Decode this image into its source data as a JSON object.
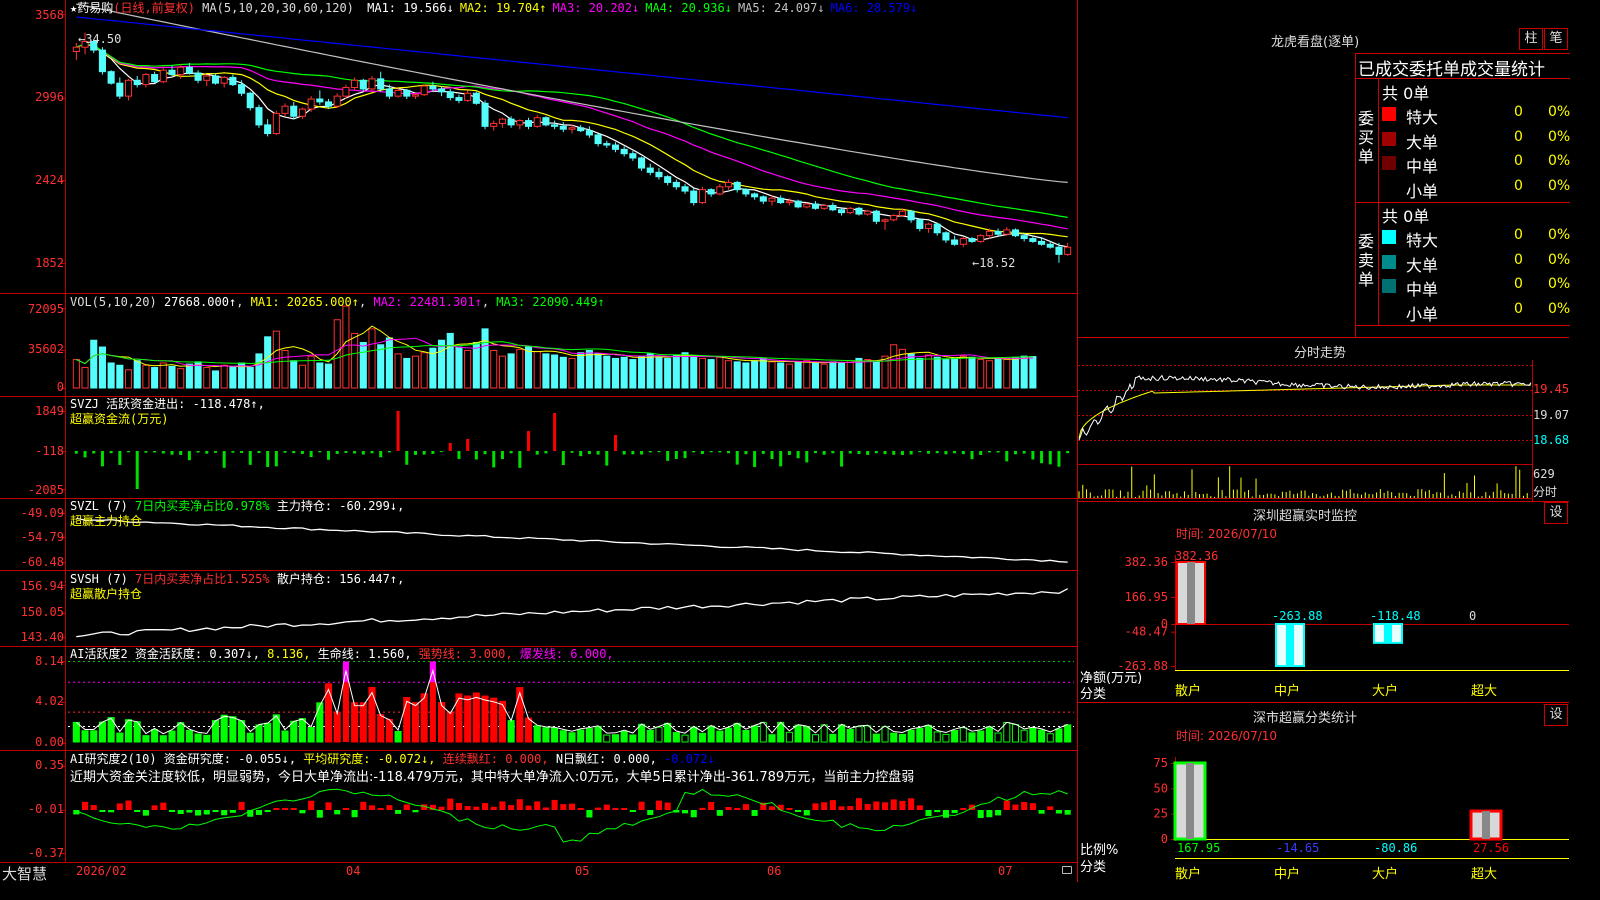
{
  "header": {
    "star": "★",
    "stock": "药易购",
    "mode": "(日线,前复权)",
    "ma_def": "MA(5,10,20,30,60,120)",
    "ma_items": [
      {
        "label": "MA1:",
        "value": "19.566↓",
        "color": "#ffffff"
      },
      {
        "label": "MA2:",
        "value": "19.704↑",
        "color": "#ffff00"
      },
      {
        "label": "MA3:",
        "value": "20.202↓",
        "color": "#ff00ff"
      },
      {
        "label": "MA4:",
        "value": "20.936↓",
        "color": "#00ff00"
      },
      {
        "label": "MA5:",
        "value": "24.097↓",
        "color": "#c0c0c0"
      },
      {
        "label": "MA6:",
        "value": "28.579↓",
        "color": "#0000ff"
      }
    ],
    "high_mark": "←34.50",
    "low_mark": "←18.52"
  },
  "price_axis": [
    "3568",
    "2996",
    "2424",
    "1852"
  ],
  "vol": {
    "title": "VOL(5,10,20)",
    "value": "27668.000↑",
    "ma1": "MA1: 20265.000↑",
    "ma2": "MA2: 22481.301↑",
    "ma3": "MA3: 22090.449↑",
    "axis": [
      "72095",
      "35602",
      "0"
    ]
  },
  "svzj": {
    "title": "SVZJ  活跃资金进出: -118.478↑,",
    "subtitle": "超赢资金流(万元)",
    "axis": [
      "1849",
      "-118",
      "-2085"
    ]
  },
  "svzl": {
    "title": "SVZL (7)",
    "ratio": "7日内买卖净占比0.978%",
    "hold": "主力持仓: -60.299↓,",
    "subtitle": "超赢主力持仓",
    "axis": [
      "-49.09",
      "-54.79",
      "-60.48"
    ]
  },
  "svsh": {
    "title": "SVSH (7)",
    "ratio": "7日内买卖净占比1.525%",
    "hold": "散户持仓: 156.447↑,",
    "subtitle": "超赢散户持仓",
    "axis": [
      "156.94",
      "150.05",
      "143.40"
    ]
  },
  "ai1": {
    "title": "AI活跃度2 资金活跃度: 0.307↓,",
    "v2": "8.136,",
    "life": "生命线: 1.560,",
    "strong": "强势线: 3.000,",
    "burst": "爆发线: 6.000,",
    "axis": [
      "8.14",
      "4.02",
      "0.00"
    ]
  },
  "ai2": {
    "title": "AI研究度2(10) 资金研究度: -0.055↓,",
    "avg": "平均研究度: -0.072↓,",
    "red": "连续飘红: 0.000,",
    "nday": "N日飘红: 0.000,",
    "last": "-0.072↓",
    "commentary": "近期大资金关注度较低，明显弱势，今日大单净流出:-118.479万元，其中特大单净流入:0万元，大单5日累计净出-361.789万元，当前主力控盘弱",
    "axis": [
      "0.35",
      "-0.01",
      "-0.37"
    ]
  },
  "date_axis": {
    "brand": "大智慧",
    "labels": [
      "2026/02",
      "04",
      "05",
      "06",
      "07"
    ]
  },
  "dragon": {
    "title": "龙虎看盘(逐单)",
    "btn_bar": "柱",
    "btn_pen": "笔",
    "table_title": "已成交委托单成交量统计",
    "buy_label": "委买单",
    "sell_label": "委卖单",
    "buy_total": "共 0单",
    "sell_total": "共 0单",
    "buy_rows": [
      {
        "name": "特大",
        "count": "0",
        "pct": "0%",
        "color": "#ff0000"
      },
      {
        "name": "大单",
        "count": "0",
        "pct": "0%",
        "color": "#a00000"
      },
      {
        "name": "中单",
        "count": "0",
        "pct": "0%",
        "color": "#700000"
      },
      {
        "name": "小单",
        "count": "0",
        "pct": "0%",
        "color": ""
      }
    ],
    "sell_rows": [
      {
        "name": "特大",
        "count": "0",
        "pct": "0%",
        "color": "#00ffff"
      },
      {
        "name": "大单",
        "count": "0",
        "pct": "0%",
        "color": "#008c8c"
      },
      {
        "name": "中单",
        "count": "0",
        "pct": "0%",
        "color": "#007070"
      },
      {
        "name": "小单",
        "count": "0",
        "pct": "0%",
        "color": ""
      }
    ]
  },
  "intraday": {
    "title": "分时走势",
    "axis": [
      "19.45",
      "19.07",
      "18.68"
    ],
    "vol_top": "629",
    "vol_unit": "分时"
  },
  "monitor": {
    "title": "深圳超赢实时监控",
    "btn": "设",
    "time": "时间: 2026/07/10",
    "axis": [
      "382.36",
      "166.95",
      "0",
      "-48.47",
      "-263.88"
    ],
    "ylabel": "净额(万元)",
    "xlabel": "分类"
  },
  "classify": {
    "title": "深市超赢分类统计",
    "btn": "设",
    "time": "时间: 2026/07/10",
    "axis": [
      "75",
      "50",
      "25",
      "0"
    ],
    "ylabel": "比例%",
    "xlabel": "分类"
  },
  "chart_data": [
    {
      "type": "candlestick",
      "name": "药易购 日线",
      "y_axis_ticks": [
        "3568",
        "2996",
        "2424",
        "1852"
      ],
      "ohlc": [
        [
          33.2,
          33.8,
          32.6,
          33.5
        ],
        [
          33.5,
          34.5,
          33.0,
          33.9
        ],
        [
          33.9,
          34.0,
          33.1,
          33.3
        ],
        [
          33.3,
          33.5,
          31.6,
          31.8
        ],
        [
          31.8,
          31.9,
          30.9,
          31.0
        ],
        [
          31.0,
          31.4,
          29.9,
          30.1
        ],
        [
          30.1,
          31.3,
          29.8,
          31.2
        ],
        [
          31.2,
          31.5,
          30.7,
          30.9
        ],
        [
          30.9,
          31.7,
          30.7,
          31.6
        ],
        [
          31.6,
          31.8,
          31.0,
          31.1
        ],
        [
          31.1,
          32.1,
          31.0,
          31.9
        ],
        [
          31.9,
          32.2,
          31.5,
          31.6
        ],
        [
          31.6,
          32.3,
          31.3,
          32.1
        ],
        [
          32.1,
          32.4,
          31.6,
          31.7
        ],
        [
          31.7,
          31.9,
          31.0,
          31.2
        ],
        [
          31.2,
          31.6,
          30.8,
          31.5
        ],
        [
          31.5,
          31.7,
          30.9,
          31.0
        ],
        [
          31.0,
          31.5,
          30.7,
          31.4
        ],
        [
          31.4,
          31.6,
          30.8,
          30.9
        ],
        [
          30.9,
          31.2,
          30.1,
          30.3
        ],
        [
          30.3,
          30.4,
          29.1,
          29.3
        ],
        [
          29.3,
          29.5,
          27.9,
          28.1
        ],
        [
          28.1,
          28.5,
          27.3,
          27.5
        ],
        [
          27.5,
          29.1,
          27.4,
          28.9
        ],
        [
          28.9,
          29.6,
          28.7,
          29.4
        ],
        [
          29.4,
          29.7,
          28.5,
          28.7
        ],
        [
          28.7,
          29.3,
          28.5,
          29.2
        ],
        [
          29.2,
          30.1,
          29.0,
          29.9
        ],
        [
          29.9,
          30.5,
          29.5,
          29.7
        ],
        [
          29.7,
          29.9,
          29.2,
          29.4
        ],
        [
          29.4,
          30.3,
          29.3,
          30.1
        ],
        [
          30.1,
          30.9,
          29.9,
          30.7
        ],
        [
          30.7,
          31.4,
          30.5,
          31.2
        ],
        [
          31.2,
          31.3,
          30.4,
          30.6
        ],
        [
          30.6,
          31.5,
          30.5,
          31.3
        ],
        [
          31.3,
          31.8,
          30.4,
          30.6
        ],
        [
          30.6,
          30.9,
          29.9,
          30.1
        ],
        [
          30.1,
          30.7,
          30.0,
          30.5
        ],
        [
          30.5,
          30.6,
          29.9,
          30.1
        ],
        [
          30.1,
          30.3,
          29.9,
          30.2
        ],
        [
          30.2,
          30.9,
          30.1,
          30.8
        ],
        [
          30.8,
          31.1,
          30.4,
          30.6
        ],
        [
          30.6,
          30.8,
          30.1,
          30.4
        ],
        [
          30.4,
          30.6,
          29.8,
          30.0
        ],
        [
          30.0,
          30.2,
          29.6,
          29.8
        ],
        [
          29.8,
          30.5,
          29.7,
          30.3
        ],
        [
          30.3,
          30.4,
          29.5,
          29.6
        ],
        [
          29.6,
          29.8,
          27.8,
          28.0
        ],
        [
          28.0,
          28.4,
          27.7,
          28.2
        ],
        [
          28.2,
          28.6,
          27.9,
          28.5
        ],
        [
          28.5,
          28.7,
          27.9,
          28.1
        ],
        [
          28.1,
          28.5,
          27.8,
          28.4
        ],
        [
          28.4,
          28.6,
          27.8,
          28.0
        ],
        [
          28.0,
          28.8,
          27.9,
          28.6
        ],
        [
          28.6,
          28.7,
          28.0,
          28.1
        ],
        [
          28.1,
          28.4,
          27.8,
          28.0
        ],
        [
          28.0,
          28.3,
          27.6,
          27.8
        ],
        [
          27.8,
          28.1,
          27.5,
          27.9
        ],
        [
          27.9,
          28.1,
          27.6,
          27.7
        ],
        [
          27.7,
          28.0,
          27.2,
          27.4
        ],
        [
          27.4,
          27.5,
          26.6,
          26.8
        ],
        [
          26.8,
          27.0,
          26.5,
          26.7
        ],
        [
          26.7,
          26.9,
          26.2,
          26.4
        ],
        [
          26.4,
          26.6,
          25.9,
          26.1
        ],
        [
          26.1,
          26.3,
          25.6,
          25.8
        ],
        [
          25.8,
          25.9,
          24.9,
          25.1
        ],
        [
          25.1,
          25.4,
          24.6,
          24.8
        ],
        [
          24.8,
          25.1,
          24.3,
          24.5
        ],
        [
          24.5,
          24.6,
          23.9,
          24.1
        ],
        [
          24.1,
          24.3,
          23.6,
          23.8
        ],
        [
          23.8,
          24.0,
          23.3,
          23.5
        ],
        [
          23.5,
          23.7,
          22.5,
          22.7
        ],
        [
          22.7,
          23.8,
          22.6,
          23.6
        ],
        [
          23.6,
          23.7,
          23.1,
          23.3
        ],
        [
          23.3,
          24.0,
          23.2,
          23.8
        ],
        [
          23.8,
          24.3,
          23.6,
          24.1
        ],
        [
          24.1,
          24.2,
          23.4,
          23.6
        ],
        [
          23.6,
          23.7,
          23.1,
          23.3
        ],
        [
          23.3,
          23.4,
          22.9,
          23.1
        ],
        [
          23.1,
          23.2,
          22.6,
          22.8
        ],
        [
          22.8,
          23.2,
          22.5,
          23.0
        ],
        [
          23.0,
          23.2,
          22.6,
          22.7
        ],
        [
          22.7,
          23.0,
          22.5,
          22.8
        ],
        [
          22.8,
          22.9,
          22.3,
          22.4
        ],
        [
          22.4,
          22.7,
          22.3,
          22.6
        ],
        [
          22.6,
          22.8,
          22.2,
          22.3
        ],
        [
          22.3,
          22.6,
          22.2,
          22.5
        ],
        [
          22.5,
          22.7,
          22.1,
          22.2
        ],
        [
          22.2,
          22.3,
          21.8,
          22.0
        ],
        [
          22.0,
          22.4,
          21.9,
          22.3
        ],
        [
          22.3,
          22.4,
          21.8,
          21.9
        ],
        [
          21.9,
          22.2,
          21.8,
          22.1
        ],
        [
          22.1,
          22.2,
          21.2,
          21.4
        ],
        [
          21.4,
          21.6,
          20.8,
          21.5
        ],
        [
          21.5,
          21.9,
          21.4,
          21.8
        ],
        [
          21.8,
          22.3,
          21.7,
          22.1
        ],
        [
          22.1,
          22.2,
          21.3,
          21.5
        ],
        [
          21.5,
          21.6,
          20.7,
          20.9
        ],
        [
          20.9,
          21.3,
          20.6,
          21.2
        ],
        [
          21.2,
          21.3,
          20.4,
          20.6
        ],
        [
          20.6,
          20.7,
          19.9,
          20.1
        ],
        [
          20.1,
          20.4,
          19.7,
          19.8
        ],
        [
          19.8,
          20.3,
          19.6,
          20.2
        ],
        [
          20.2,
          20.3,
          19.9,
          20.0
        ],
        [
          20.0,
          20.5,
          19.9,
          20.4
        ],
        [
          20.4,
          20.9,
          20.2,
          20.7
        ],
        [
          20.7,
          20.9,
          20.3,
          20.5
        ],
        [
          20.5,
          21.0,
          20.4,
          20.8
        ],
        [
          20.8,
          20.9,
          20.3,
          20.4
        ],
        [
          20.4,
          20.6,
          20.0,
          20.2
        ],
        [
          20.2,
          20.4,
          19.9,
          20.0
        ],
        [
          20.0,
          20.3,
          19.7,
          19.8
        ],
        [
          19.8,
          20.0,
          19.5,
          19.6
        ],
        [
          19.6,
          19.9,
          18.52,
          19.1
        ],
        [
          19.1,
          19.9,
          19.0,
          19.6
        ]
      ],
      "ma_lines": [
        {
          "name": "MA1",
          "color": "#ffffff"
        },
        {
          "name": "MA2",
          "color": "#ffff00"
        },
        {
          "name": "MA3",
          "color": "#ff00ff"
        },
        {
          "name": "MA4",
          "color": "#00ff00"
        },
        {
          "name": "MA5",
          "color": "#c0c0c0",
          "start": 36.5,
          "end": 24.1
        },
        {
          "name": "MA6",
          "color": "#0000ff",
          "start": 35.6,
          "end": 28.6
        }
      ]
    },
    {
      "type": "bar",
      "name": "VOL",
      "y_axis_ticks": [
        "72095",
        "35602",
        "0"
      ],
      "values": [
        25000,
        18000,
        42000,
        36000,
        22000,
        20000,
        16000,
        24000,
        20000,
        18000,
        22000,
        19000,
        17000,
        21000,
        23000,
        18000,
        15000,
        20000,
        19000,
        22000,
        18000,
        30000,
        45000,
        50000,
        33000,
        24000,
        20000,
        28000,
        22000,
        21000,
        60000,
        72000,
        48000,
        40000,
        52000,
        38000,
        44000,
        30000,
        26000,
        28000,
        31000,
        35000,
        42000,
        48000,
        36000,
        33000,
        40000,
        52000,
        33000,
        28000,
        30000,
        34000,
        36000,
        32000,
        30000,
        29000,
        27000,
        26000,
        31000,
        33000,
        30000,
        28000,
        26000,
        27000,
        25000,
        28000,
        30000,
        27000,
        26000,
        29000,
        31000,
        28000,
        26000,
        25000,
        27000,
        24000,
        23000,
        22000,
        24000,
        26000,
        23000,
        22000,
        21000,
        23000,
        24000,
        22000,
        21000,
        23000,
        22000,
        24000,
        26000,
        25000,
        23000,
        28000,
        38000,
        34000,
        30000,
        26000,
        29000,
        27000,
        25000,
        26000,
        28000,
        27000,
        25000,
        24000,
        26000,
        25000,
        27000,
        28000,
        27668
      ]
    },
    {
      "type": "bar",
      "name": "活跃资金进出",
      "y_axis_ticks": [
        "1849",
        "-118",
        "-2085"
      ]
    },
    {
      "type": "line",
      "name": "主力持仓",
      "y_axis_ticks": [
        "-49.09",
        "-54.79",
        "-60.48"
      ],
      "start": -49.6,
      "end": -60.299
    },
    {
      "type": "line",
      "name": "散户持仓",
      "y_axis_ticks": [
        "156.94",
        "150.05",
        "143.40"
      ],
      "start": 144.0,
      "end": 156.447
    },
    {
      "type": "bar",
      "name": "资金活跃度",
      "y_axis_ticks": [
        "8.14",
        "4.02",
        "0.00"
      ],
      "reference_lines": {
        "life": 1.56,
        "strong": 3.0,
        "burst": 6.0
      }
    },
    {
      "type": "bar",
      "name": "资金研究度",
      "y_axis_ticks": [
        "0.35",
        "-0.01",
        "-0.37"
      ]
    },
    {
      "type": "bar",
      "name": "深圳超赢实时监控",
      "categories": [
        "散户",
        "中户",
        "大户",
        "超大"
      ],
      "values": [
        382.36,
        -263.88,
        -118.48,
        0
      ],
      "labels": [
        "382.36",
        "-263.88",
        "-118.48",
        "0"
      ],
      "ylim": [
        -263.88,
        382.36
      ]
    },
    {
      "type": "bar",
      "name": "深市超赢分类统计",
      "categories": [
        "散户",
        "中户",
        "大户",
        "超大"
      ],
      "values": [
        167.95,
        -14.65,
        -80.86,
        27.56
      ],
      "labels": [
        "167.95",
        "-14.65",
        "-80.86",
        "27.56"
      ],
      "ylim": [
        0,
        75
      ]
    }
  ]
}
